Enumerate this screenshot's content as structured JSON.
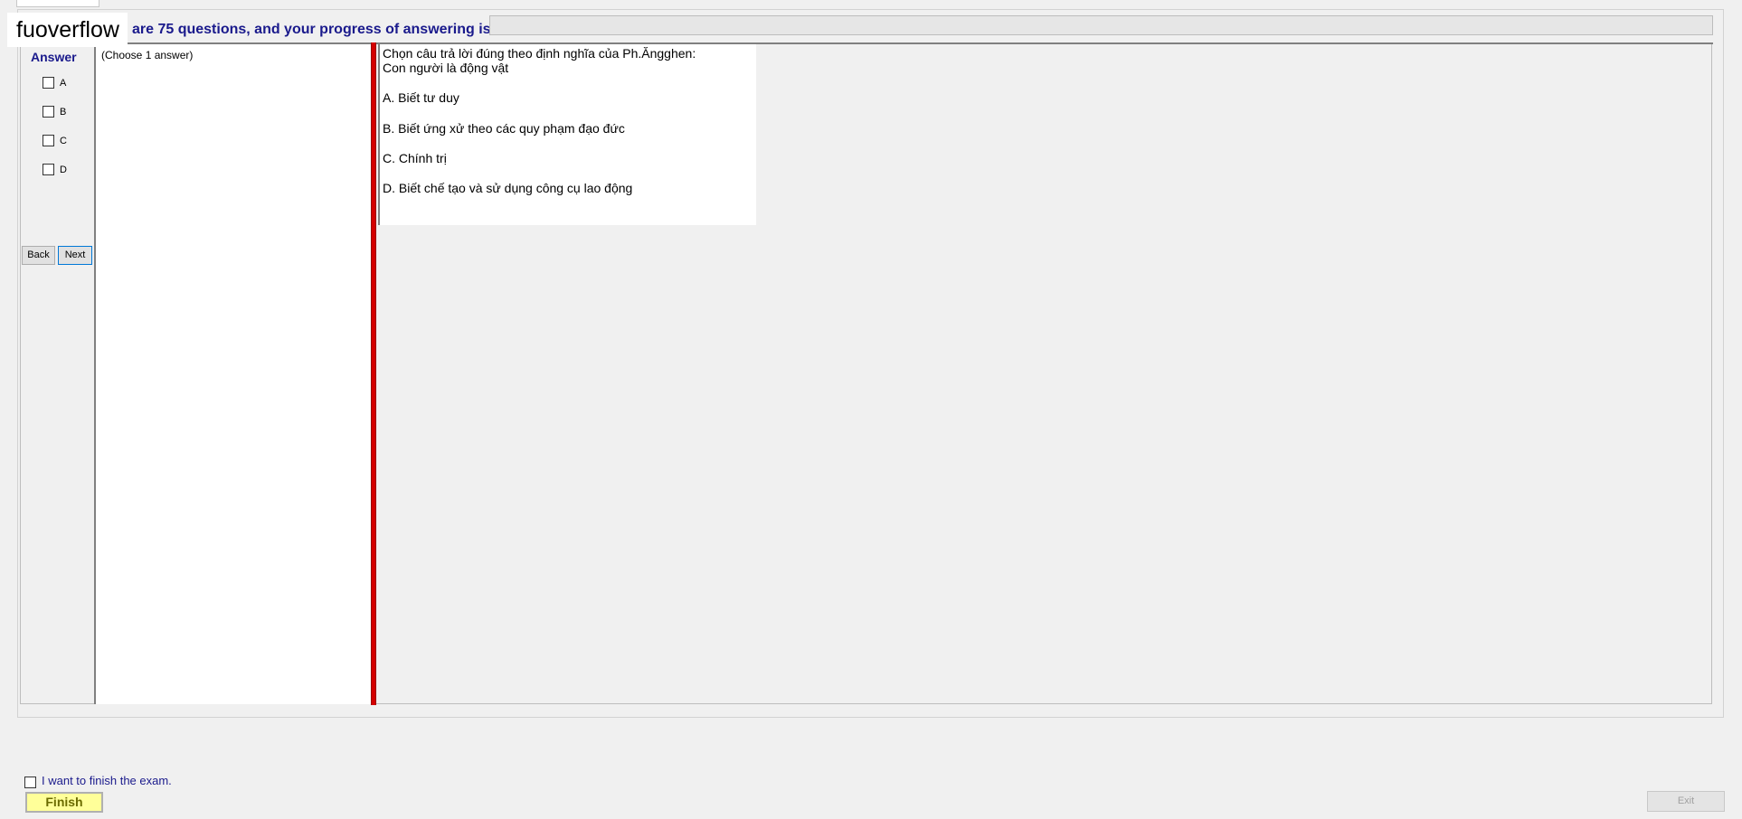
{
  "watermark": "fuoverflow",
  "header": {
    "text": "are 75 questions, and your progress of answering is",
    "progress_fraction": 0
  },
  "answer_panel": {
    "title": "Answer",
    "options": [
      "A",
      "B",
      "C",
      "D"
    ],
    "back_label": "Back",
    "next_label": "Next"
  },
  "choose_text": "(Choose 1 answer)",
  "question": {
    "lines": [
      "Chọn câu trả lời đúng theo định nghĩa của Ph.Ăngghen:",
      "Con người là động vật"
    ],
    "options": [
      "A.  Biết tư duy",
      "B.  Biết ứng xử theo các quy phạm đạo đức",
      "C.  Chính trị",
      "D.  Biết chế tạo và sử dụng công cụ lao động"
    ]
  },
  "footer": {
    "finish_check_label": "I want to finish the exam.",
    "finish_label": "Finish",
    "exit_label": "Exit"
  }
}
